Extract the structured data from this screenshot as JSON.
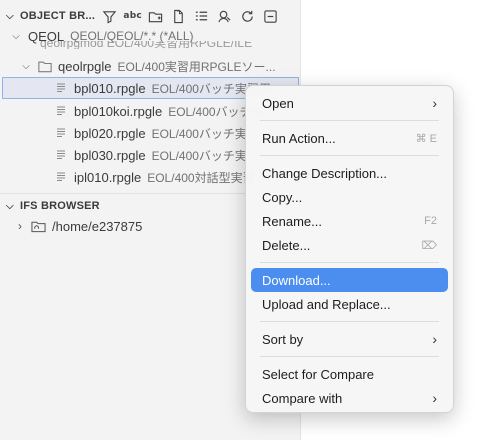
{
  "object_browser": {
    "title": "OBJECT BR...",
    "toolbar": [
      {
        "name": "filter-icon",
        "glyph": ""
      },
      {
        "name": "abc-icon",
        "glyph": "abc"
      },
      {
        "name": "new-folder-icon",
        "glyph": ""
      },
      {
        "name": "new-file-icon",
        "glyph": ""
      },
      {
        "name": "list-icon",
        "glyph": ""
      },
      {
        "name": "search-person-icon",
        "glyph": ""
      },
      {
        "name": "refresh-icon",
        "glyph": ""
      },
      {
        "name": "collapse-all-icon",
        "glyph": ""
      }
    ],
    "tree": {
      "root_label": "QEOL",
      "root_desc": "QEOL/QEOL/*.* (*ALL)",
      "cut_text": "qeolrpgmod  EOL/400実習用RPGLE/ILE",
      "folder_label": "qeolrpgle",
      "folder_desc": "EOL/400実習用RPGLEソー...",
      "files": [
        {
          "label": "bpl010.rpgle",
          "desc": "EOL/400バッチ実習用"
        },
        {
          "label": "bpl010koi.rpgle",
          "desc": "EOL/400バッチ実"
        },
        {
          "label": "bpl020.rpgle",
          "desc": "EOL/400バッチ実"
        },
        {
          "label": "bpl030.rpgle",
          "desc": "EOL/400バッチ実"
        },
        {
          "label": "ipl010.rpgle",
          "desc": "EOL/400対話型実習"
        }
      ]
    }
  },
  "ifs_browser": {
    "title": "IFS BROWSER",
    "home_label": "/home/e237875"
  },
  "context_menu": {
    "open": "Open",
    "run_action": "Run Action...",
    "run_action_kb": "⌘ E",
    "change_description": "Change Description...",
    "copy": "Copy...",
    "rename": "Rename...",
    "rename_kb": "F2",
    "delete": "Delete...",
    "delete_kb": "⌦",
    "download": "Download...",
    "upload_replace": "Upload and Replace...",
    "sort_by": "Sort by",
    "select_compare": "Select for Compare",
    "compare_with": "Compare with",
    "submenu_arrow": "›"
  }
}
